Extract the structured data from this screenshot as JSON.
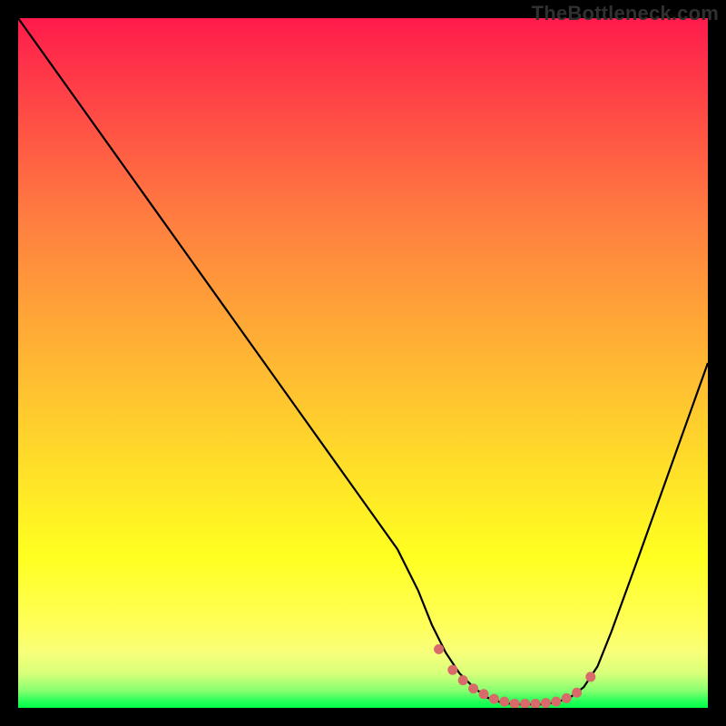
{
  "watermark": "TheBottleneck.com",
  "chart_data": {
    "type": "line",
    "title": "",
    "xlabel": "",
    "ylabel": "",
    "xlim": [
      0,
      100
    ],
    "ylim": [
      0,
      100
    ],
    "series": [
      {
        "name": "curve",
        "x": [
          0,
          5,
          10,
          15,
          20,
          25,
          30,
          35,
          40,
          45,
          50,
          55,
          58,
          60,
          62,
          64,
          66,
          68,
          70,
          72,
          74,
          76,
          78,
          80,
          82,
          84,
          86,
          90,
          95,
          100
        ],
        "y": [
          100,
          93,
          86,
          79,
          72,
          65,
          58,
          51,
          44,
          37,
          30,
          23,
          17,
          12,
          8,
          5,
          3,
          1.5,
          0.8,
          0.5,
          0.5,
          0.5,
          0.8,
          1.5,
          3,
          6,
          11,
          22,
          36,
          50
        ]
      }
    ],
    "markers": {
      "name": "highlight-dots",
      "x": [
        61,
        63,
        64.5,
        66,
        67.5,
        69,
        70.5,
        72,
        73.5,
        75,
        76.5,
        78,
        79.5,
        81,
        83
      ],
      "y": [
        8.5,
        5.5,
        4,
        2.8,
        2,
        1.3,
        0.9,
        0.6,
        0.6,
        0.6,
        0.7,
        0.9,
        1.4,
        2.2,
        4.5
      ]
    },
    "colors": {
      "curve": "#000000",
      "markers": "#d86a6a",
      "background_top": "#ff1a4c",
      "background_bottom": "#00ff48"
    }
  }
}
